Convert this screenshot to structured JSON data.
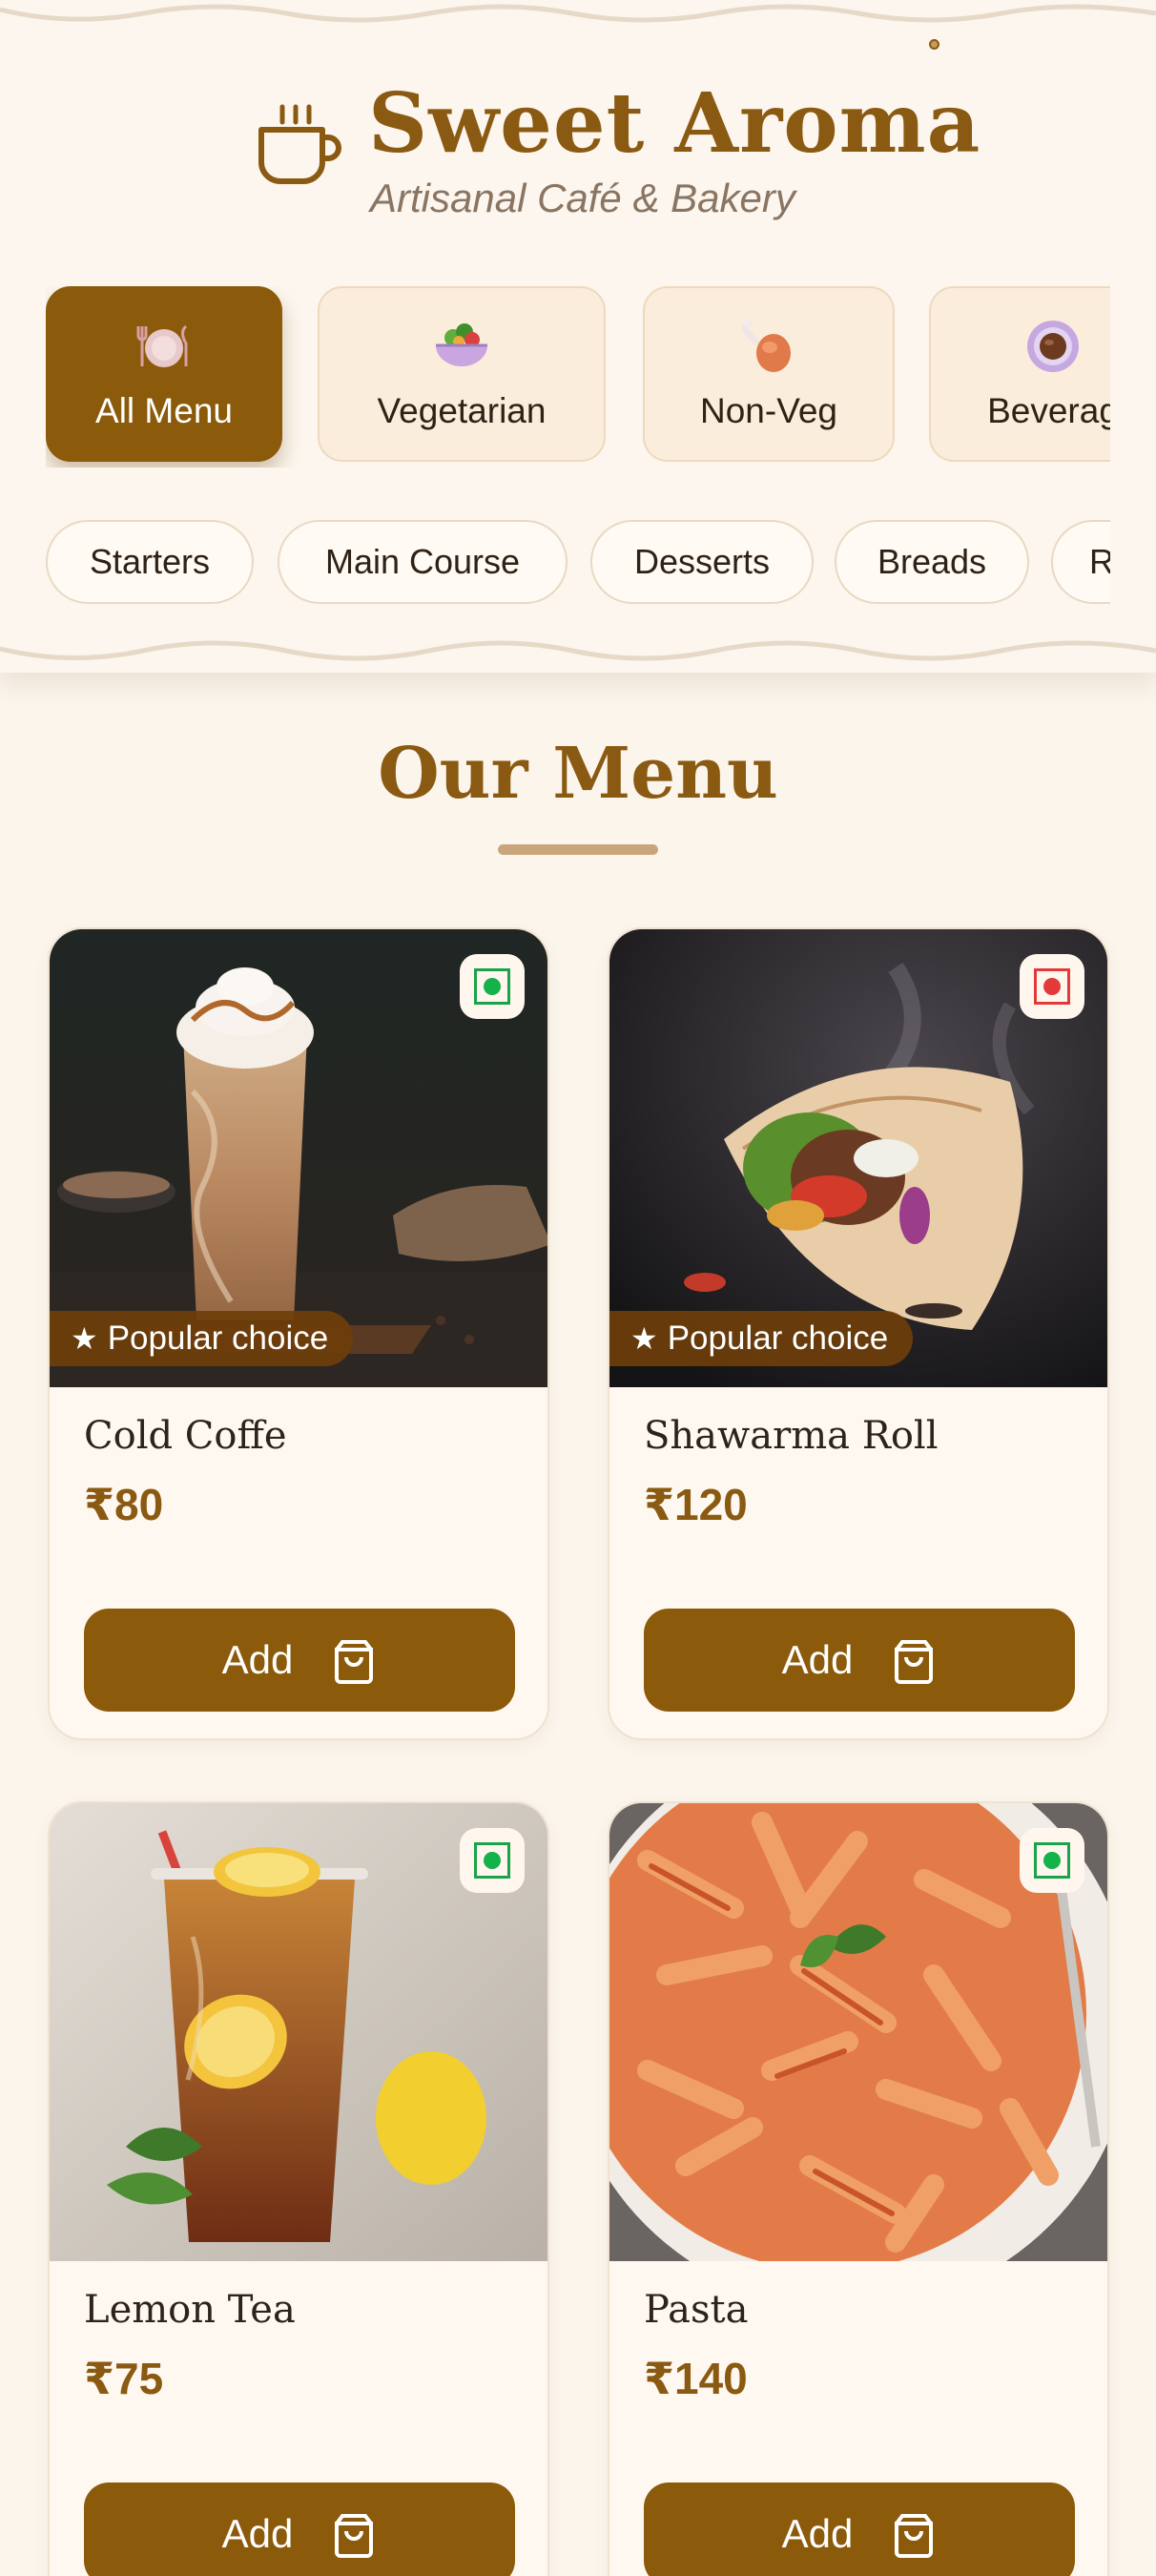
{
  "brand": {
    "title": "Sweet Aroma",
    "subtitle": "Artisanal Café & Bakery",
    "accent": "#8b5a12"
  },
  "categories": [
    {
      "label": "All Menu",
      "icon": "plate-cutlery-icon",
      "active": true
    },
    {
      "label": "Vegetarian",
      "icon": "salad-bowl-icon",
      "active": false
    },
    {
      "label": "Non-Veg",
      "icon": "chicken-leg-icon",
      "active": false
    },
    {
      "label": "Beverag",
      "icon": "coffee-cup-icon",
      "active": false
    }
  ],
  "subcategories": [
    "Starters",
    "Main Course",
    "Desserts",
    "Breads",
    "R"
  ],
  "menu": {
    "title": "Our Menu",
    "items": [
      {
        "name": "Cold Coffe",
        "price": "₹80",
        "badge": "Popular choice",
        "diet": "veg",
        "add_label": "Add"
      },
      {
        "name": "Shawarma Roll",
        "price": "₹120",
        "badge": "Popular choice",
        "diet": "non-veg",
        "add_label": "Add"
      },
      {
        "name": "Lemon Tea",
        "price": "₹75",
        "diet": "veg",
        "add_label": "Add"
      },
      {
        "name": "Pasta",
        "price": "₹140",
        "diet": "veg",
        "add_label": "Add"
      }
    ]
  },
  "colors": {
    "veg": "#13b24a",
    "non_veg": "#e23a3a",
    "button": "#8b5a0a",
    "background": "#fbf5ec"
  }
}
